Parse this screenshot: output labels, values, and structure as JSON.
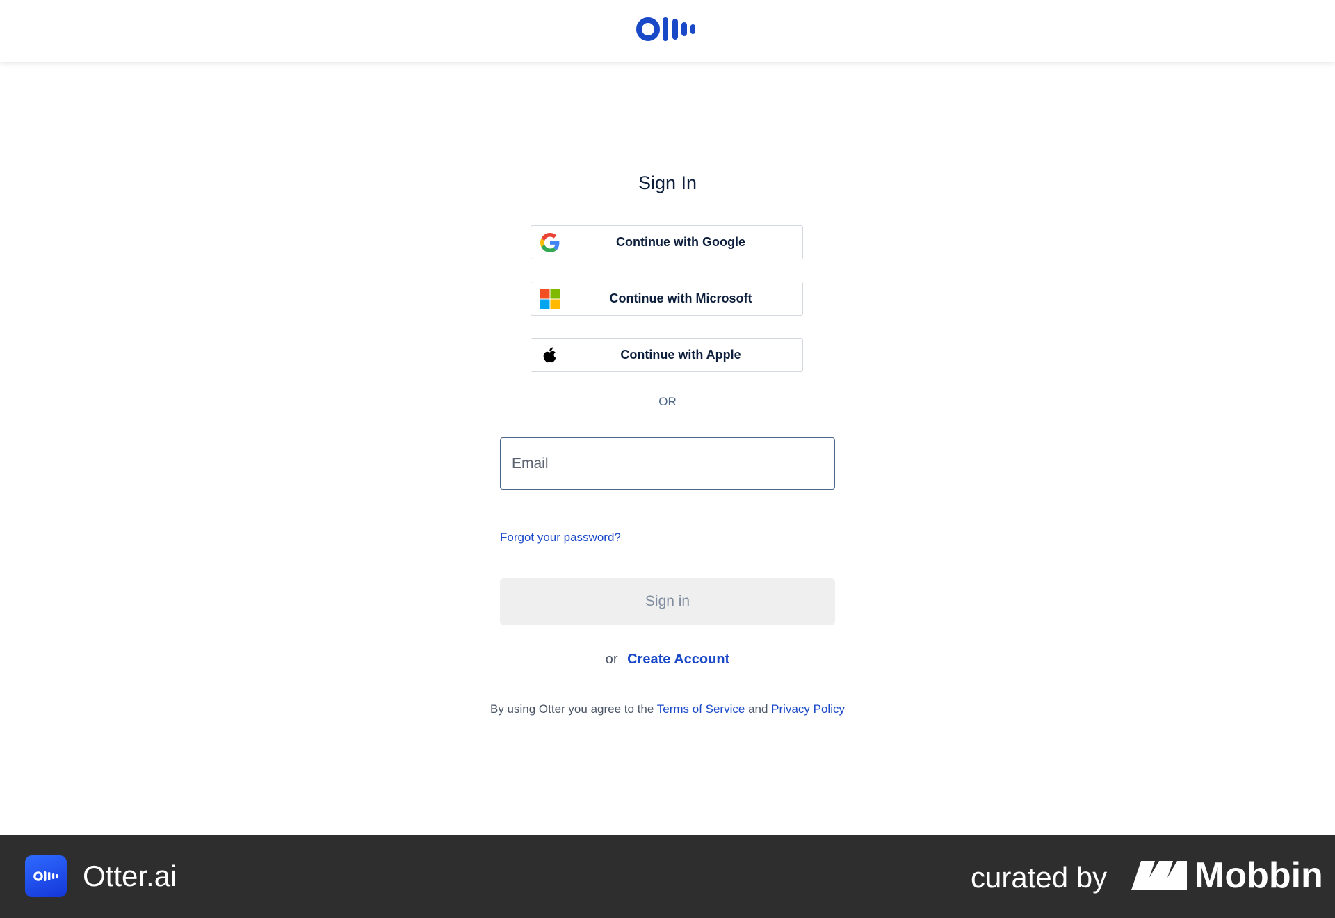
{
  "header": {
    "logo_icon": "otter-logo-icon",
    "brand_color": "#1a49c8"
  },
  "page": {
    "title": "Sign In"
  },
  "sso": {
    "google_label": "Continue with Google",
    "microsoft_label": "Continue with Microsoft",
    "apple_label": "Continue with Apple"
  },
  "divider": {
    "label": "OR"
  },
  "form": {
    "email_placeholder": "Email",
    "email_value": "",
    "forgot_label": "Forgot your password?",
    "signin_label": "Sign in"
  },
  "create": {
    "prefix": "or",
    "link_label": "Create Account"
  },
  "terms": {
    "prefix": "By using Otter you agree to the",
    "tos_label": "Terms of Service",
    "conjunction": "and",
    "privacy_label": "Privacy Policy"
  },
  "footer": {
    "app_icon": "otter-app-icon",
    "app_name": "Otter.ai",
    "curated_label": "curated by",
    "mobbin_logo_icon": "mobbin-logo-icon",
    "mobbin_name": "Mobbin",
    "background": "#2e2e2e"
  }
}
